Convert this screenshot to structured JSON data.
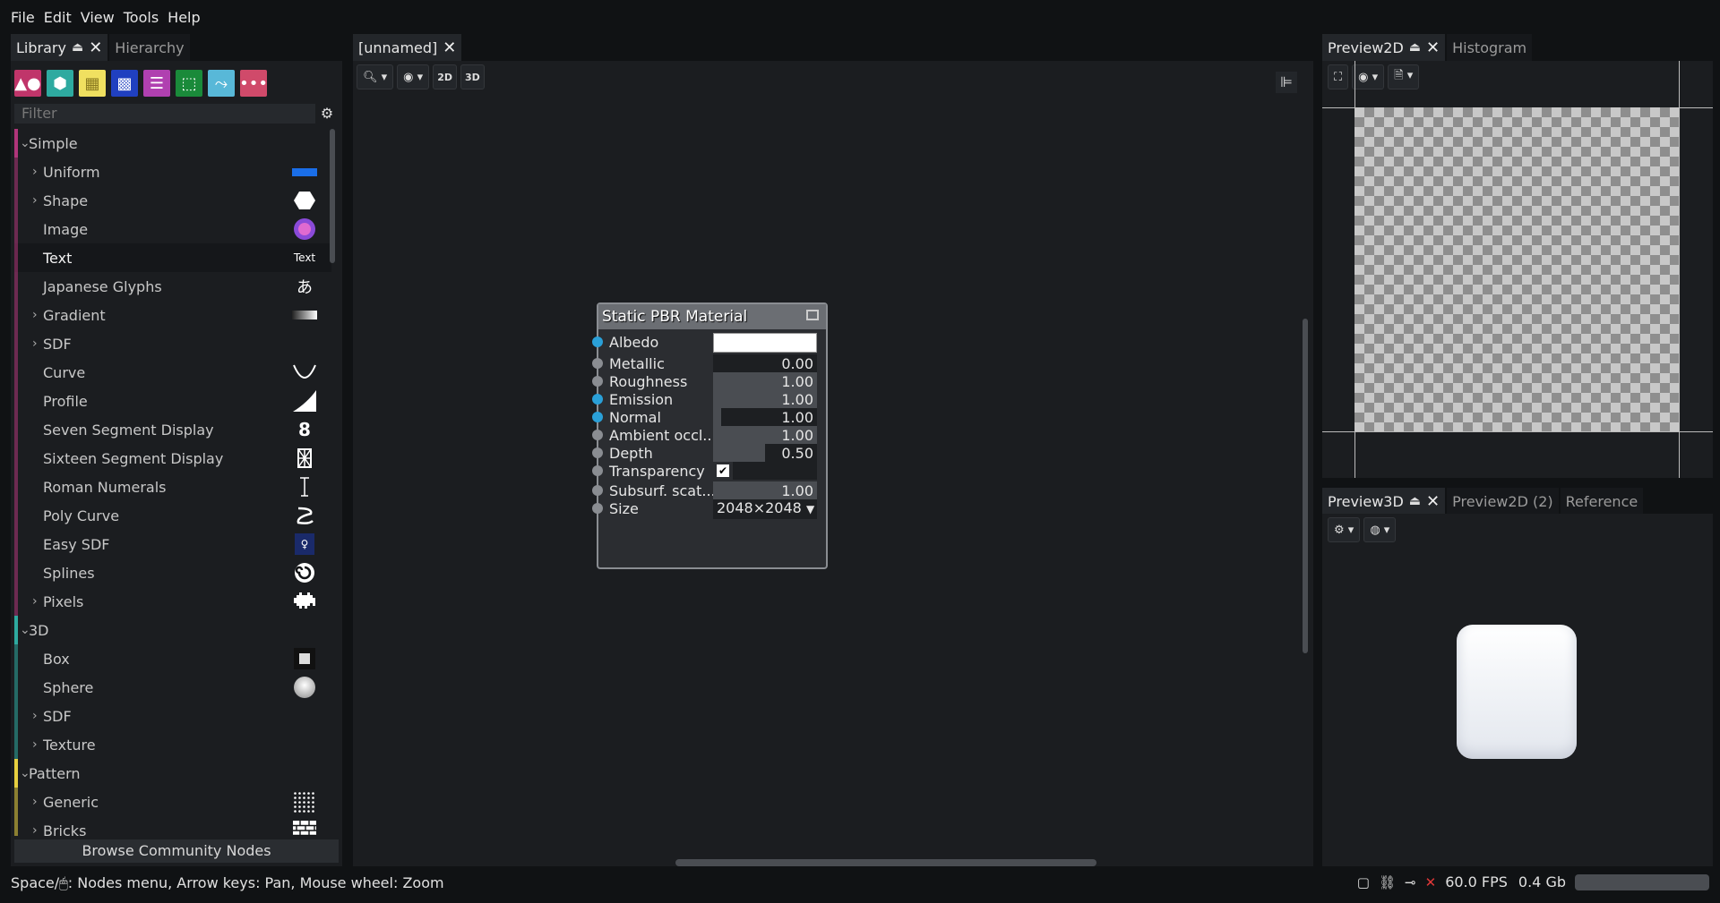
{
  "menu": [
    "File",
    "Edit",
    "View",
    "Tools",
    "Help"
  ],
  "library": {
    "tabs": [
      {
        "label": "Library",
        "active": true
      },
      {
        "label": "Hierarchy",
        "active": false
      }
    ],
    "filter_placeholder": "Filter",
    "browse_label": "Browse Community Nodes",
    "icon_names": [
      "shapes-icon",
      "cube-icon",
      "bricks-icon",
      "noise-icon",
      "sliders-icon",
      "selection-icon",
      "flow-icon",
      "more-icon"
    ],
    "icon_colors": [
      "#c0356a",
      "#2eaaa0",
      "#f0e060",
      "#2040c0",
      "#b040b0",
      "#1a8a3a",
      "#58b8d8",
      "#d04a6a"
    ],
    "categories": [
      {
        "name": "Simple",
        "color": "#b0357a",
        "items": [
          {
            "label": "Uniform",
            "expandable": true
          },
          {
            "label": "Shape",
            "expandable": true
          },
          {
            "label": "Image",
            "expandable": false
          },
          {
            "label": "Text",
            "expandable": false,
            "selected": true,
            "thumb_text": "Text"
          },
          {
            "label": "Japanese Glyphs",
            "expandable": false,
            "thumb_text": "あ"
          },
          {
            "label": "Gradient",
            "expandable": true
          },
          {
            "label": "SDF",
            "expandable": true
          },
          {
            "label": "Curve",
            "expandable": false
          },
          {
            "label": "Profile",
            "expandable": false
          },
          {
            "label": "Seven Segment Display",
            "expandable": false,
            "thumb_text": "8"
          },
          {
            "label": "Sixteen Segment Display",
            "expandable": false
          },
          {
            "label": "Roman Numerals",
            "expandable": false
          },
          {
            "label": "Poly Curve",
            "expandable": false
          },
          {
            "label": "Easy SDF",
            "expandable": false
          },
          {
            "label": "Splines",
            "expandable": false
          },
          {
            "label": "Pixels",
            "expandable": true
          }
        ]
      },
      {
        "name": "3D",
        "color": "#2eaaa0",
        "items": [
          {
            "label": "Box",
            "expandable": false
          },
          {
            "label": "Sphere",
            "expandable": false
          },
          {
            "label": "SDF",
            "expandable": true
          },
          {
            "label": "Texture",
            "expandable": true
          }
        ]
      },
      {
        "name": "Pattern",
        "color": "#e8d040",
        "items": [
          {
            "label": "Generic",
            "expandable": true
          },
          {
            "label": "Bricks",
            "expandable": true
          }
        ]
      }
    ]
  },
  "graph": {
    "tab_label": "[unnamed]",
    "btn_2d": "2D",
    "btn_3d": "3D",
    "node": {
      "title": "Static PBR Material",
      "ports": [
        {
          "label": "Albedo",
          "kind": "color",
          "value": "#ffffff",
          "connected": true
        },
        {
          "label": "Metallic",
          "kind": "float",
          "value": "0.00",
          "fill": 0.0,
          "connected": false
        },
        {
          "label": "Roughness",
          "kind": "float",
          "value": "1.00",
          "fill": 1.0,
          "connected": false
        },
        {
          "label": "Emission",
          "kind": "float",
          "value": "1.00",
          "fill": 1.0,
          "connected": true
        },
        {
          "label": "Normal",
          "kind": "float",
          "value": "1.00",
          "fill": 0.08,
          "connected": true
        },
        {
          "label": "Ambient occl...",
          "kind": "float",
          "value": "1.00",
          "fill": 1.0,
          "connected": false
        },
        {
          "label": "Depth",
          "kind": "float",
          "value": "0.50",
          "fill": 0.5,
          "connected": false
        },
        {
          "label": "Transparency",
          "kind": "bool",
          "value": true,
          "connected": false
        },
        {
          "label": "Subsurf. scat...",
          "kind": "float",
          "value": "1.00",
          "fill": 1.0,
          "connected": false
        },
        {
          "label": "Size",
          "kind": "select",
          "value": "2048×2048",
          "connected": false
        }
      ]
    }
  },
  "preview2d": {
    "tabs": [
      {
        "label": "Preview2D",
        "active": true
      },
      {
        "label": "Histogram",
        "active": false
      }
    ]
  },
  "preview3d": {
    "tabs": [
      {
        "label": "Preview3D",
        "active": true
      },
      {
        "label": "Preview2D (2)",
        "active": false
      },
      {
        "label": "Reference",
        "active": false
      }
    ]
  },
  "status": {
    "hint_prefix": "Space/",
    "hint_suffix": ": Nodes menu, Arrow keys: Pan, Mouse wheel: Zoom",
    "fps": "60.0 FPS",
    "memory": "0.4 Gb"
  }
}
